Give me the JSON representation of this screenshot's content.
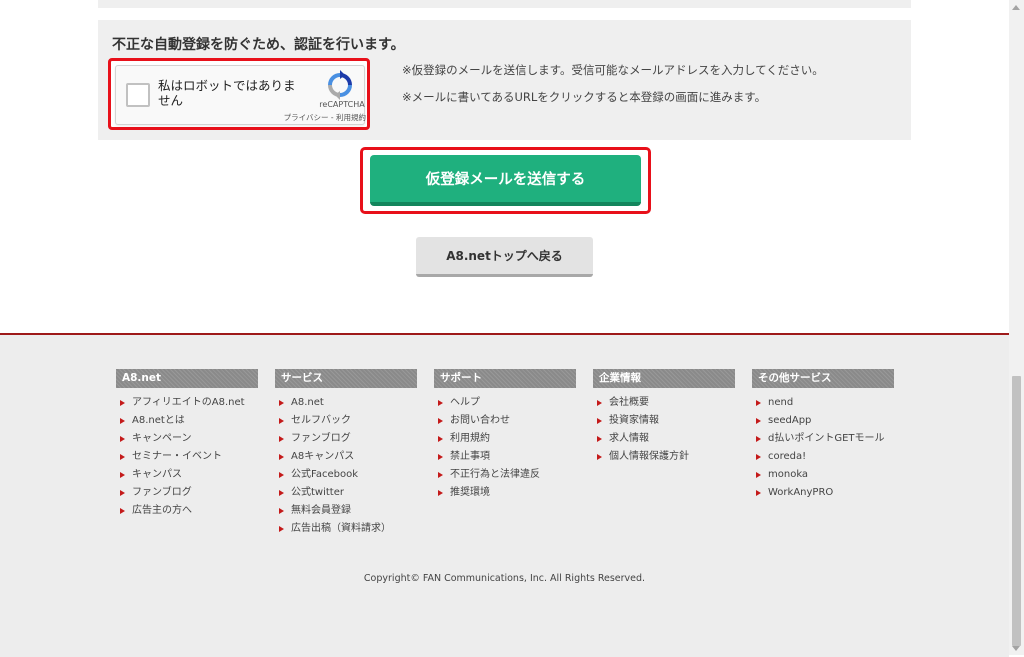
{
  "auth": {
    "title": "不正な自動登録を防ぐため、認証を行います。",
    "captcha_label": "私はロボットではありません",
    "recaptcha_name": "reCAPTCHA",
    "recaptcha_links": "プライバシー - 利用規約",
    "note1": "※仮登録のメールを送信します。受信可能なメールアドレスを入力してください。",
    "note2": "※メールに書いてあるURLをクリックすると本登録の画面に進みます。"
  },
  "buttons": {
    "submit": "仮登録メールを送信する",
    "back": "A8.netトップへ戻る"
  },
  "footer": {
    "columns": [
      {
        "heading": "A8.net",
        "links": [
          "アフィリエイトのA8.net",
          "A8.netとは",
          "キャンペーン",
          "セミナー・イベント",
          "キャンパス",
          "ファンブログ",
          "広告主の方へ"
        ]
      },
      {
        "heading": "サービス",
        "links": [
          "A8.net",
          "セルフバック",
          "ファンブログ",
          "A8キャンパス",
          "公式Facebook",
          "公式twitter",
          "無料会員登録",
          "広告出稿（資料請求）"
        ]
      },
      {
        "heading": "サポート",
        "links": [
          "ヘルプ",
          "お問い合わせ",
          "利用規約",
          "禁止事項",
          "不正行為と法律違反",
          "推奨環境"
        ]
      },
      {
        "heading": "企業情報",
        "links": [
          "会社概要",
          "投資家情報",
          "求人情報",
          "個人情報保護方針"
        ]
      },
      {
        "heading": "その他サービス",
        "links": [
          "nend",
          "seedApp",
          "d払いポイントGETモール",
          "coreda!",
          "monoka",
          "WorkAnyPRO"
        ]
      }
    ],
    "copyright": "Copyright© FAN Communications, Inc. All Rights Reserved."
  },
  "colors": {
    "submit_green": "#1fb07e",
    "highlight_red": "#e8101a",
    "footer_border": "#9e1a1a",
    "bullet_red": "#c41a1a"
  }
}
